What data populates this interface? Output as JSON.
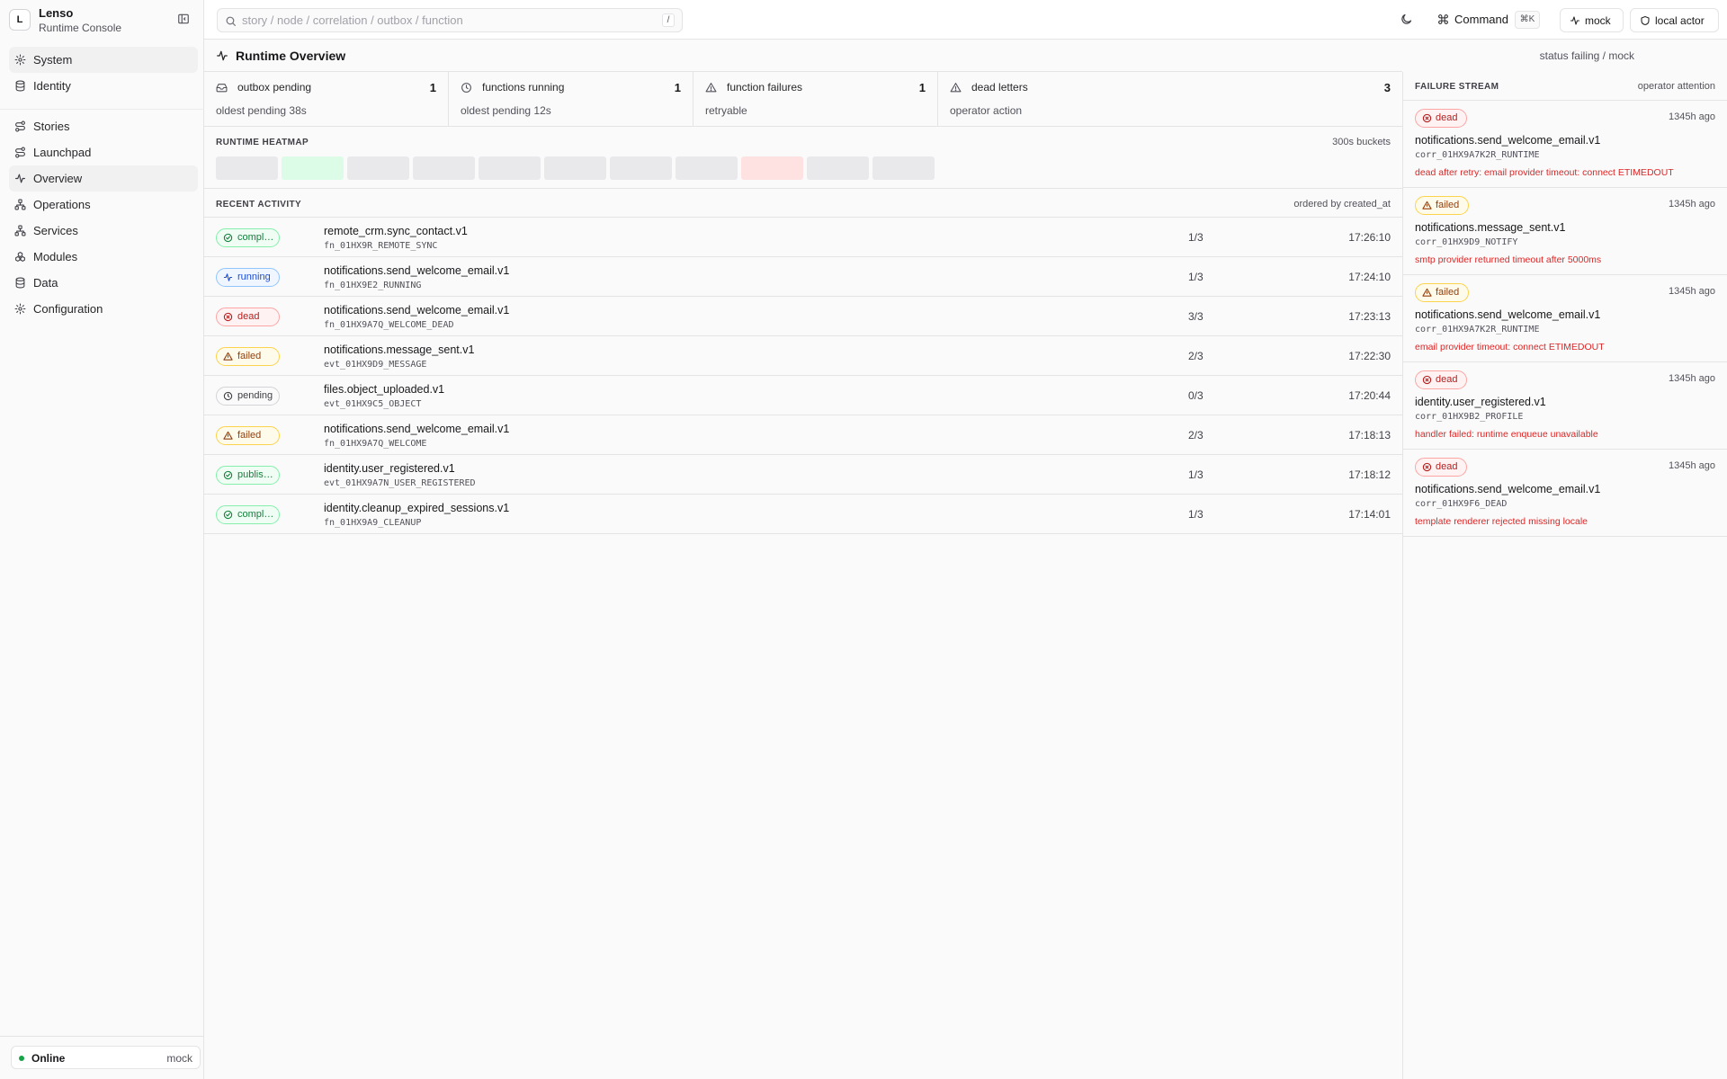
{
  "app": {
    "logo_letter": "L",
    "name": "Lenso",
    "subtitle": "Runtime Console"
  },
  "sidebar": {
    "groups": [
      [
        {
          "label": "System",
          "icon": "gear-icon",
          "active": true
        },
        {
          "label": "Identity",
          "icon": "database-icon",
          "active": false
        }
      ],
      [
        {
          "label": "Stories",
          "icon": "route-icon",
          "active": false
        },
        {
          "label": "Launchpad",
          "icon": "route-icon",
          "active": false
        },
        {
          "label": "Overview",
          "icon": "activity-icon",
          "active": true
        },
        {
          "label": "Operations",
          "icon": "network-icon",
          "active": false
        },
        {
          "label": "Services",
          "icon": "network-icon",
          "active": false
        },
        {
          "label": "Modules",
          "icon": "boxes-icon",
          "active": false
        },
        {
          "label": "Data",
          "icon": "database-icon",
          "active": false
        },
        {
          "label": "Configuration",
          "icon": "gear-icon",
          "active": false
        }
      ]
    ],
    "status": {
      "label": "Online",
      "mode": "mock",
      "color": "#16a34a"
    }
  },
  "topbar": {
    "search_placeholder": "story / node / correlation / outbox / function",
    "search_shortcut": "/",
    "command_label": "Command",
    "command_shortcut": "⌘K",
    "mode_label": "mock",
    "actor_label": "local actor"
  },
  "page": {
    "title": "Runtime Overview",
    "status": "status failing / mock"
  },
  "stats": [
    {
      "label": "outbox pending",
      "value": "1",
      "sub": "oldest pending 38s",
      "icon": "inbox-icon"
    },
    {
      "label": "functions running",
      "value": "1",
      "sub": "oldest pending 12s",
      "icon": "clock-icon"
    },
    {
      "label": "function failures",
      "value": "1",
      "sub": "retryable",
      "icon": "warning-icon"
    },
    {
      "label": "dead letters",
      "value": "3",
      "sub": "operator action",
      "icon": "warning-icon"
    }
  ],
  "heatmap": {
    "title": "Runtime Heatmap",
    "note": "300s buckets",
    "cells": [
      "neutral",
      "success",
      "neutral",
      "neutral",
      "neutral",
      "neutral",
      "neutral",
      "neutral",
      "error",
      "neutral",
      "neutral"
    ],
    "colors": {
      "neutral": "#e9e9ec",
      "success": "#dcfce7",
      "error": "#fee2e2"
    }
  },
  "activity": {
    "title": "Recent Activity",
    "note": "ordered by created_at",
    "rows": [
      {
        "status": "success",
        "badge": "completed",
        "name": "remote_crm.sync_contact.v1",
        "id": "fn_01HX9R_REMOTE_SYNC",
        "tries": "1/3",
        "time": "17:26:10"
      },
      {
        "status": "running",
        "badge": "running",
        "name": "notifications.send_welcome_email.v1",
        "id": "fn_01HX9E2_RUNNING",
        "tries": "1/3",
        "time": "17:24:10"
      },
      {
        "status": "dead",
        "badge": "dead",
        "name": "notifications.send_welcome_email.v1",
        "id": "fn_01HX9A7Q_WELCOME_DEAD",
        "tries": "3/3",
        "time": "17:23:13"
      },
      {
        "status": "failed",
        "badge": "failed",
        "name": "notifications.message_sent.v1",
        "id": "evt_01HX9D9_MESSAGE",
        "tries": "2/3",
        "time": "17:22:30"
      },
      {
        "status": "pending",
        "badge": "pending",
        "name": "files.object_uploaded.v1",
        "id": "evt_01HX9C5_OBJECT",
        "tries": "0/3",
        "time": "17:20:44"
      },
      {
        "status": "failed",
        "badge": "failed",
        "name": "notifications.send_welcome_email.v1",
        "id": "fn_01HX9A7Q_WELCOME",
        "tries": "2/3",
        "time": "17:18:13"
      },
      {
        "status": "success",
        "badge": "published",
        "name": "identity.user_registered.v1",
        "id": "evt_01HX9A7N_USER_REGISTERED",
        "tries": "1/3",
        "time": "17:18:12"
      },
      {
        "status": "success",
        "badge": "completed",
        "name": "identity.cleanup_expired_sessions.v1",
        "id": "fn_01HX9A9_CLEANUP",
        "tries": "1/3",
        "time": "17:14:01"
      }
    ]
  },
  "failure_stream": {
    "title": "Failure Stream",
    "note": "operator attention",
    "items": [
      {
        "status": "dead",
        "badge": "dead",
        "ago": "1345h ago",
        "name": "notifications.send_welcome_email.v1",
        "corr": "corr_01HX9A7K2R_RUNTIME",
        "error": "dead after retry: email provider timeout: connect ETIMEDOUT"
      },
      {
        "status": "failed",
        "badge": "failed",
        "ago": "1345h ago",
        "name": "notifications.message_sent.v1",
        "corr": "corr_01HX9D9_NOTIFY",
        "error": "smtp provider returned timeout after 5000ms"
      },
      {
        "status": "failed",
        "badge": "failed",
        "ago": "1345h ago",
        "name": "notifications.send_welcome_email.v1",
        "corr": "corr_01HX9A7K2R_RUNTIME",
        "error": "email provider timeout: connect ETIMEDOUT"
      },
      {
        "status": "dead",
        "badge": "dead",
        "ago": "1345h ago",
        "name": "identity.user_registered.v1",
        "corr": "corr_01HX9B2_PROFILE",
        "error": "handler failed: runtime enqueue unavailable"
      },
      {
        "status": "dead",
        "badge": "dead",
        "ago": "1345h ago",
        "name": "notifications.send_welcome_email.v1",
        "corr": "corr_01HX9F6_DEAD",
        "error": "template renderer rejected missing locale"
      }
    ]
  }
}
